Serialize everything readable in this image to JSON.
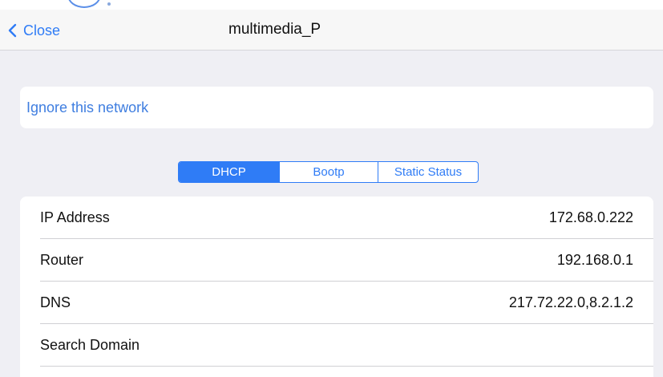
{
  "nav": {
    "back_label": "Close",
    "back_icon": "chevron-left-icon",
    "title": "multimedia_P"
  },
  "ignore": {
    "label": "Ignore this network"
  },
  "segments": [
    {
      "label": "DHCP",
      "selected": true
    },
    {
      "label": "Bootp",
      "selected": false
    },
    {
      "label": "Static Status",
      "selected": false
    }
  ],
  "rows": [
    {
      "label": "IP Address",
      "value": "172.68.0.222"
    },
    {
      "label": "Router",
      "value": "192.168.0.1"
    },
    {
      "label": "DNS",
      "value": "217.72.22.0,8.2.1.2"
    },
    {
      "label": "Search Domain",
      "value": ""
    }
  ],
  "colors": {
    "accent": "#2f7cf6",
    "background": "#efeff4",
    "card": "#ffffff",
    "nav_bar": "#f7f7f7"
  }
}
